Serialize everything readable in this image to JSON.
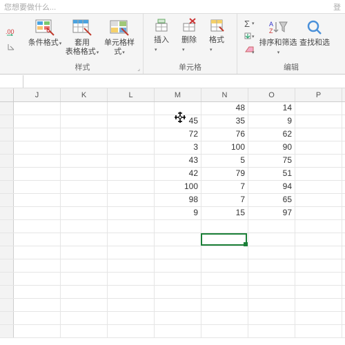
{
  "search": {
    "placeholder": "您想要做什么...",
    "right_text": "登"
  },
  "ribbon": {
    "styles": {
      "cond": "条件格式",
      "table": "套用\n表格格式",
      "cell": "单元格样式",
      "label": "样式"
    },
    "cells": {
      "insert": "插入",
      "delete": "删除",
      "format": "格式",
      "label": "单元格"
    },
    "editing": {
      "sortfilter": "排序和筛选",
      "find": "查找和选",
      "label": "编辑"
    }
  },
  "columns": [
    "J",
    "K",
    "L",
    "M",
    "N",
    "O",
    "P"
  ],
  "grid": {
    "rows": [
      {
        "M": "",
        "N": 48,
        "O": 14
      },
      {
        "M": 45,
        "N": 35,
        "O": 9
      },
      {
        "M": 72,
        "N": 76,
        "O": 62
      },
      {
        "M": 3,
        "N": 100,
        "O": 90
      },
      {
        "M": 43,
        "N": 5,
        "O": 75
      },
      {
        "M": 42,
        "N": 79,
        "O": 51
      },
      {
        "M": 100,
        "N": 7,
        "O": 94
      },
      {
        "M": 98,
        "N": 7,
        "O": 65
      },
      {
        "M": 9,
        "N": 15,
        "O": 97
      }
    ]
  },
  "chart_data": {
    "type": "table",
    "columns": [
      "M",
      "N",
      "O"
    ],
    "values": [
      [
        null,
        48,
        14
      ],
      [
        45,
        35,
        9
      ],
      [
        72,
        76,
        62
      ],
      [
        3,
        100,
        90
      ],
      [
        43,
        5,
        75
      ],
      [
        42,
        79,
        51
      ],
      [
        100,
        7,
        94
      ],
      [
        98,
        7,
        65
      ],
      [
        9,
        15,
        97
      ]
    ]
  }
}
